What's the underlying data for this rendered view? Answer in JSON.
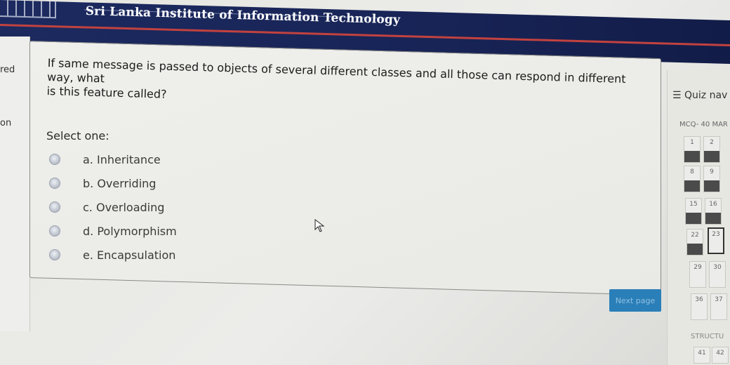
{
  "header": {
    "institute_name": "Sri Lanka Institute of Information Technology"
  },
  "left_fragments": [
    "red",
    "on"
  ],
  "question": {
    "text_line1": "If same message is passed to objects of several different classes and all those can respond in different way, what",
    "text_line2": "is this feature called?",
    "select_prompt": "Select one:",
    "options": [
      "a. Inheritance",
      "b. Overriding",
      "c. Overloading",
      "d. Polymorphism",
      "e. Encapsulation"
    ]
  },
  "next_button": {
    "label": "Next page"
  },
  "quiz_nav": {
    "title": "Quiz nav",
    "subtitle": "MCQ- 40 MAR",
    "buttons": [
      "1",
      "2",
      "8",
      "9",
      "15",
      "16",
      "22",
      "23",
      "29",
      "30",
      "36",
      "37"
    ],
    "section_label": "STRUCTU",
    "bottom_numbers": [
      "41",
      "42"
    ]
  },
  "icons": {
    "nav_menu": "hamburger-icon",
    "cursor": "mouse-cursor-icon"
  }
}
